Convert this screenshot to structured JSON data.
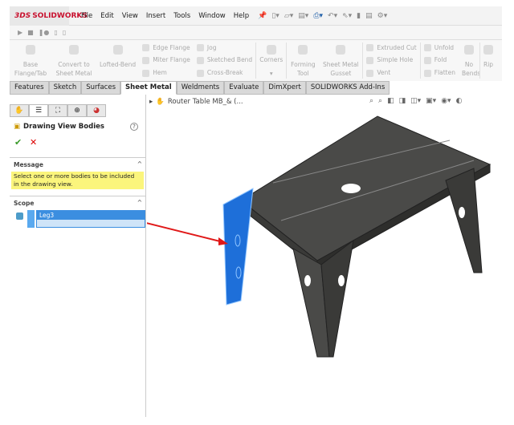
{
  "app": {
    "logo": "SOLIDWORKS",
    "logo_prefix": "3DS"
  },
  "menu": [
    "File",
    "Edit",
    "View",
    "Insert",
    "Tools",
    "Window",
    "Help"
  ],
  "ribbon": {
    "base_flange": "Base Flange/Tab",
    "convert": "Convert to Sheet Metal",
    "lofted": "Lofted-Bend",
    "col1": [
      "Edge Flange",
      "Miter Flange",
      "Hem"
    ],
    "col2": [
      "Jog",
      "Sketched Bend",
      "Cross-Break"
    ],
    "corners": "Corners",
    "forming": "Forming Tool",
    "gusset": "Sheet Metal Gusset",
    "col3": [
      "Extruded Cut",
      "Simple Hole",
      "Vent"
    ],
    "col4": [
      "Unfold",
      "Fold",
      "Flatten"
    ],
    "nobends": "No Bends",
    "rip": "Rip"
  },
  "tabs": [
    "Features",
    "Sketch",
    "Surfaces",
    "Sheet Metal",
    "Weldments",
    "Evaluate",
    "DimXpert",
    "SOLIDWORKS Add-Ins"
  ],
  "active_tab": "Sheet Metal",
  "panel": {
    "title": "Drawing View Bodies",
    "help": "?",
    "message_header": "Message",
    "message": "Select one or more bodies to be included in the drawing view.",
    "scope_header": "Scope",
    "scope_selected": "Leg3"
  },
  "tree": {
    "root": "Router Table MB_&  (..."
  },
  "colors": {
    "accent": "#3b8ee0",
    "message_bg": "#fbf57c",
    "arrow": "#e01818",
    "model": "#4a4a48"
  }
}
